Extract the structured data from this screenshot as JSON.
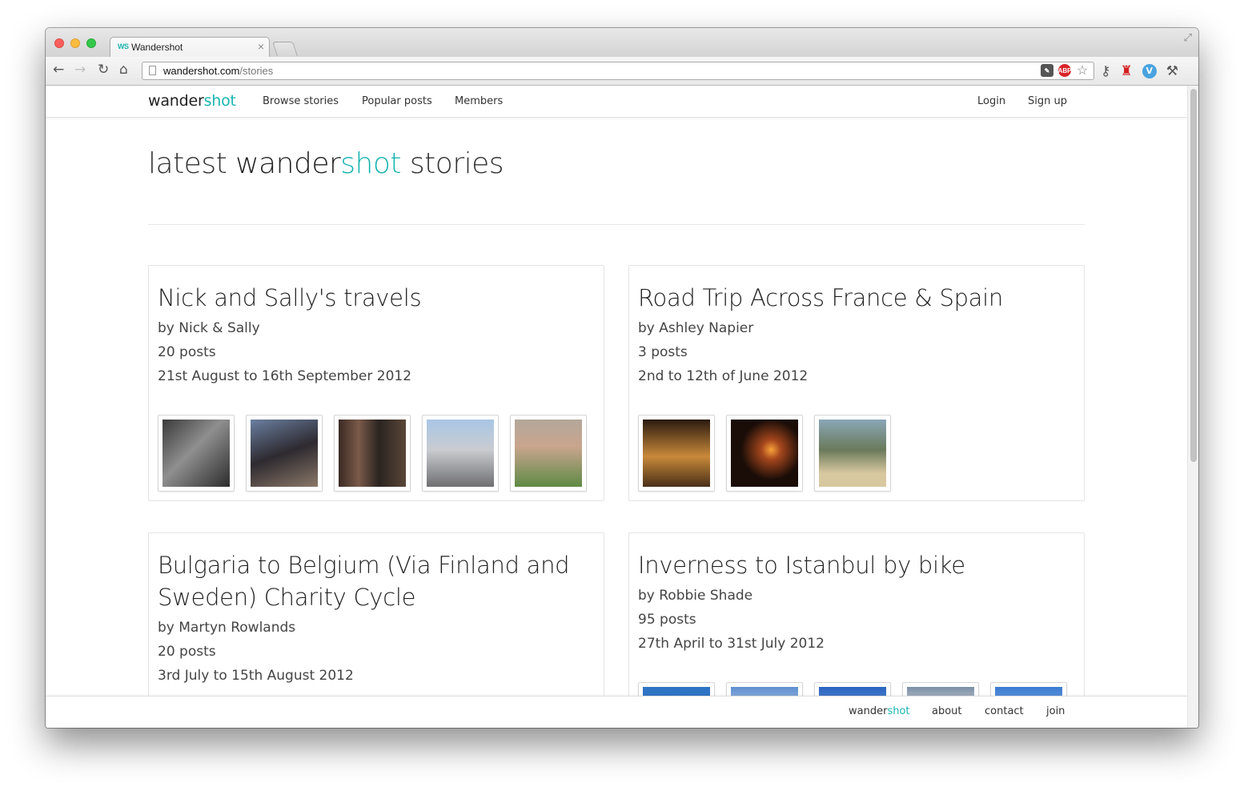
{
  "browser": {
    "tab_title": "Wandershot",
    "favicon": "WS",
    "url_host": "wandershot.com",
    "url_path": "/stories"
  },
  "navbar": {
    "brand_a": "wander",
    "brand_b": "shot",
    "links": [
      "Browse stories",
      "Popular posts",
      "Members"
    ],
    "login": "Login",
    "signup": "Sign up"
  },
  "page": {
    "title_a": "latest ",
    "title_b": "wander",
    "title_c": "shot",
    "title_d": " stories"
  },
  "stories": [
    {
      "title": "Nick and Sally's travels",
      "author": "by Nick & Sally",
      "posts": "20 posts",
      "dates": "21st August to 16th September 2012"
    },
    {
      "title": "Road Trip Across France & Spain",
      "author": "by Ashley Napier",
      "posts": "3 posts",
      "dates": "2nd to 12th of June 2012"
    },
    {
      "title": "Bulgaria to Belgium (Via Finland and Sweden) Charity Cycle",
      "author": "by Martyn Rowlands",
      "posts": "20 posts",
      "dates": "3rd July to 15th August 2012"
    },
    {
      "title": "Inverness to Istanbul by bike",
      "author": "by Robbie Shade",
      "posts": "95 posts",
      "dates": "27th April to 31st July 2012"
    }
  ],
  "footer": {
    "brand_a": "wander",
    "brand_b": "shot",
    "about": "about",
    "contact": "contact",
    "join": "join"
  },
  "colors": {
    "accent": "#19b5b1",
    "text": "#333333",
    "border": "#e4e4e4"
  }
}
